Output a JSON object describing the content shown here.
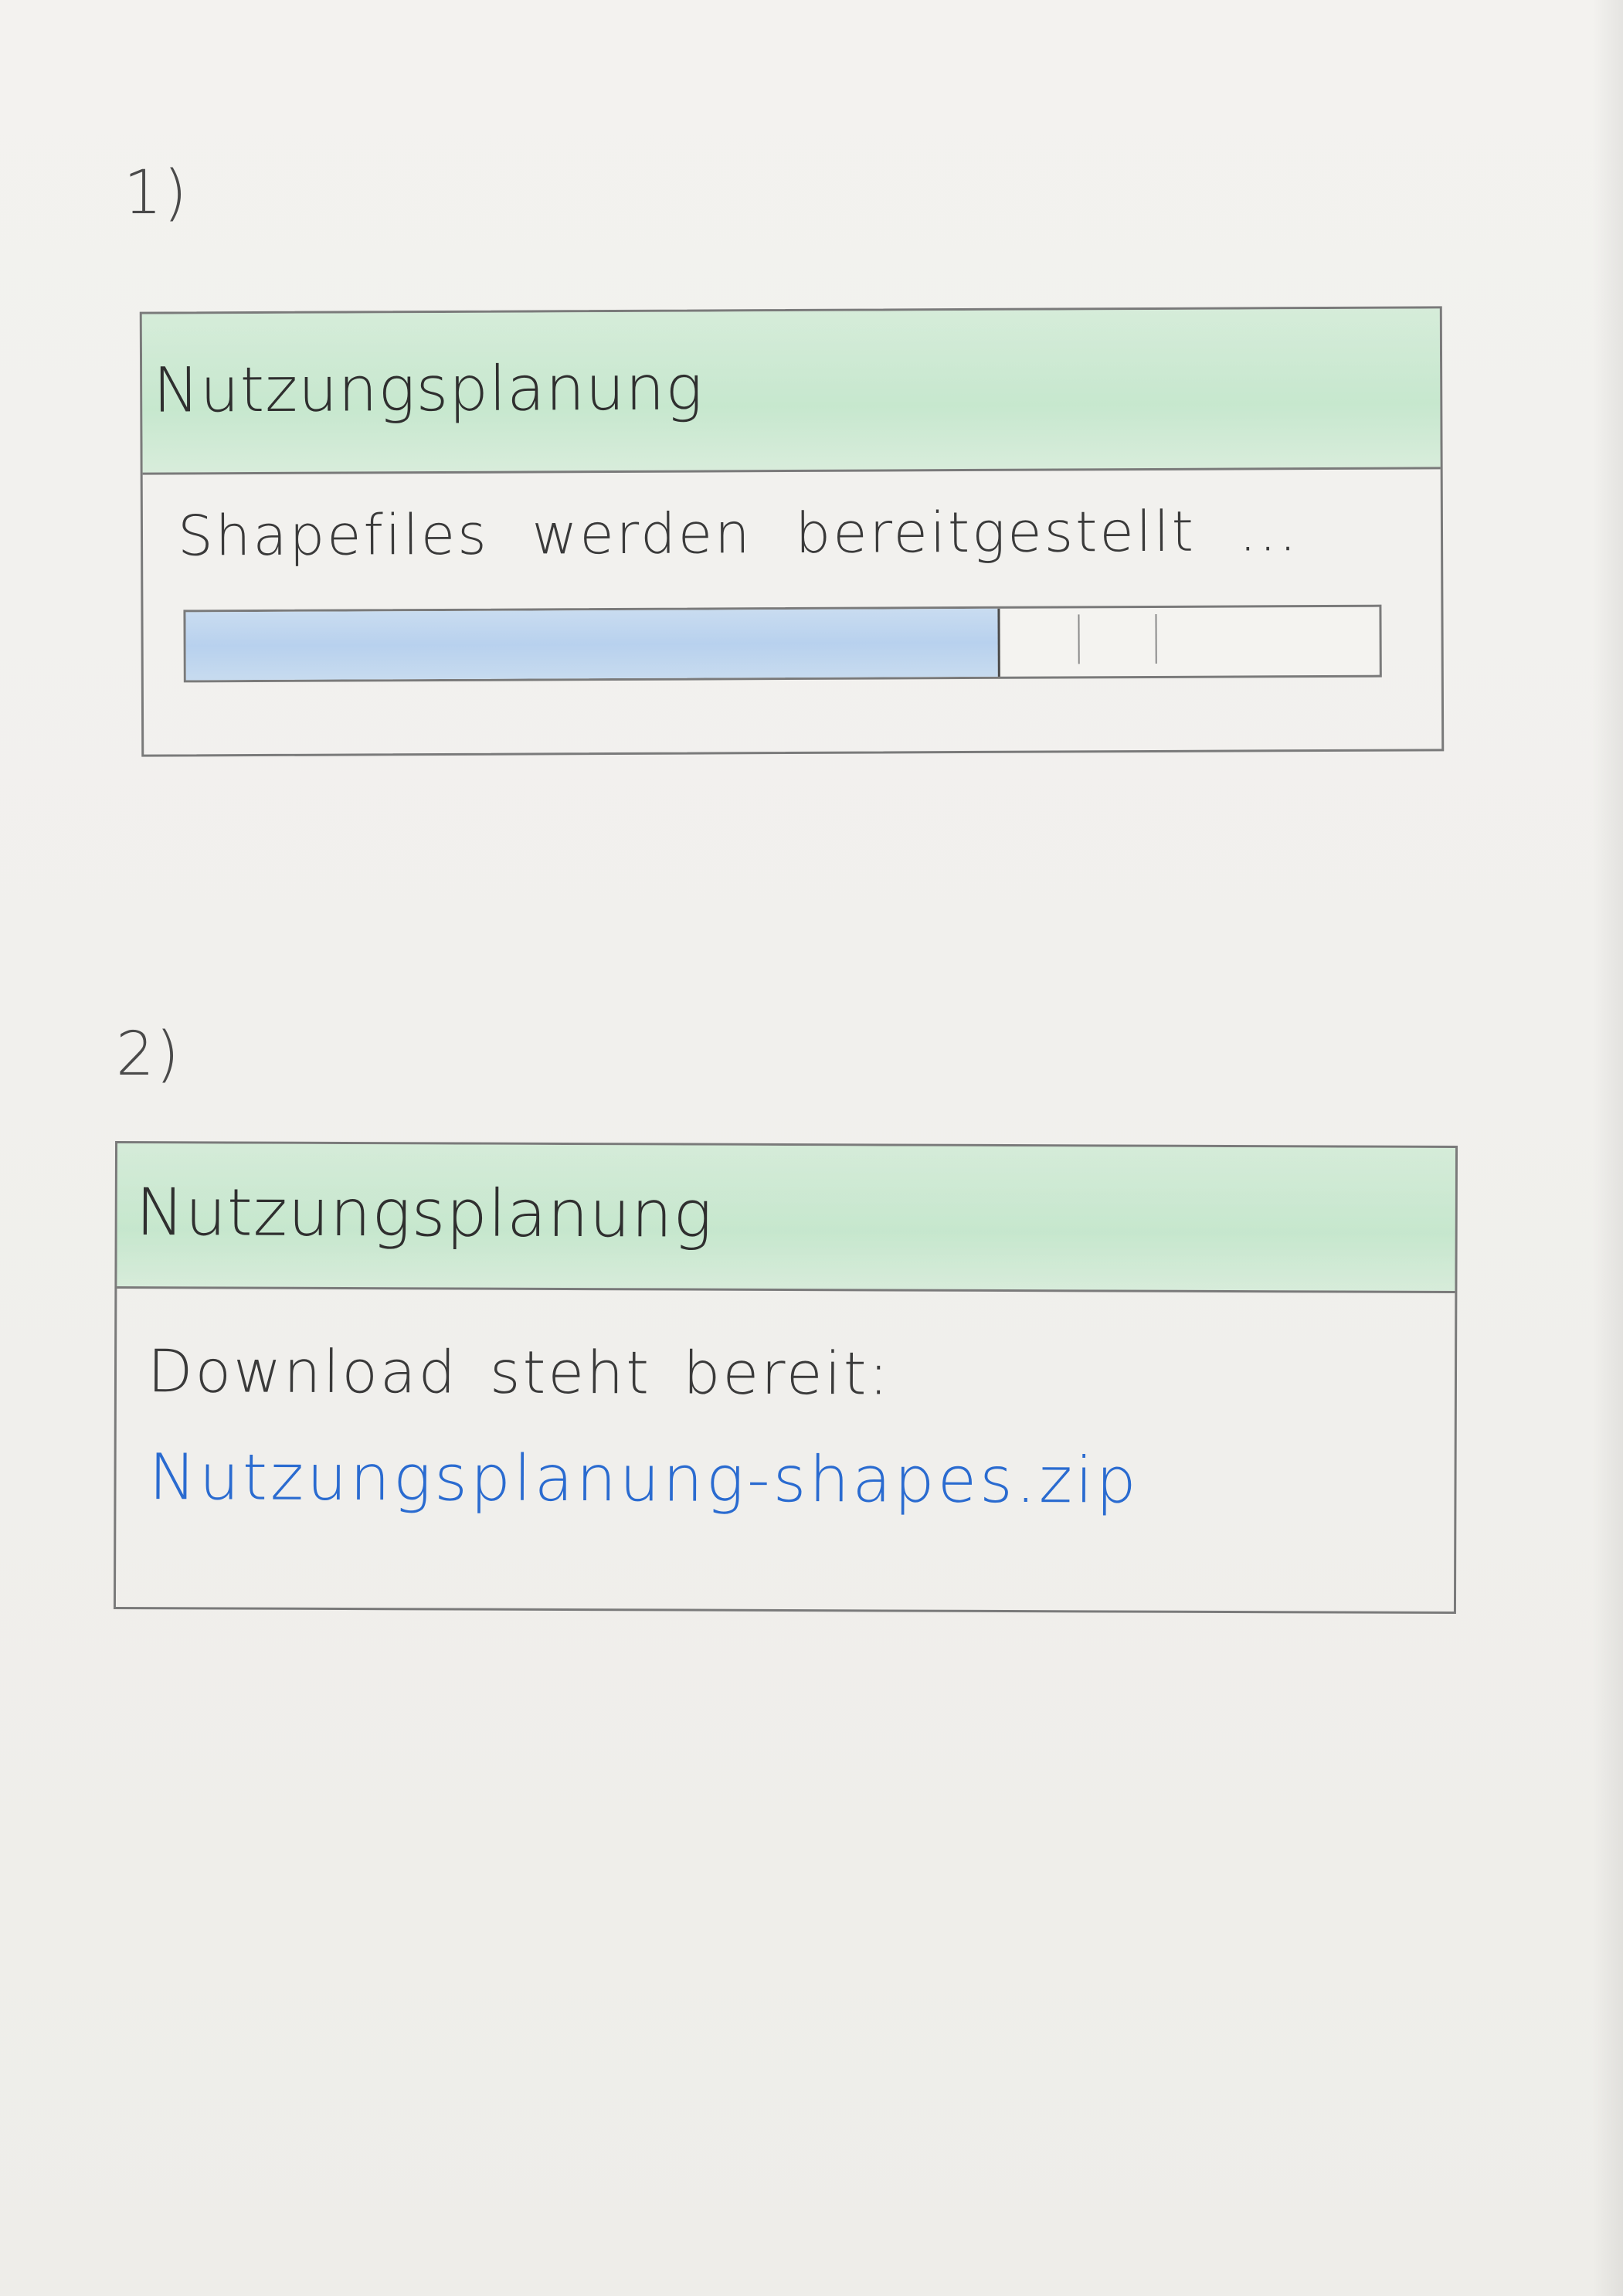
{
  "step1": {
    "number": "1)",
    "dialog": {
      "title": "Nutzungsplanung",
      "status": "Shapefiles werden bereitgestellt ...",
      "progress": 0.68
    }
  },
  "step2": {
    "number": "2)",
    "dialog": {
      "title": "Nutzungsplanung",
      "status": "Download steht bereit:",
      "link": "Nutzungsplanung-shapes.zip"
    }
  },
  "colors": {
    "header_green": "#b5e3c1",
    "progress_blue": "#bcd4ee",
    "link_blue": "#2a6bd0",
    "pencil_gray": "#7a7a7a"
  }
}
